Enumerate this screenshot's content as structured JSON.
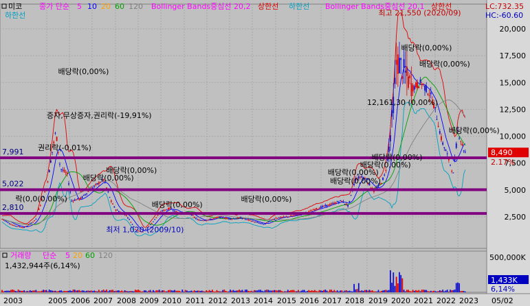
{
  "colors": {
    "bg": "#c0c0c0",
    "plot_bg": "#c0c0c0",
    "grid": "#a8a8a8",
    "up": "#e00000",
    "down": "#1010d0",
    "bb_mid": "#ff00ff",
    "bb_upper": "#e00000",
    "bb_lower": "#00a0c0",
    "ma5": "#ff00ff",
    "ma10": "#0000ff",
    "ma20": "#ffa000",
    "ma60": "#00a000",
    "ma120": "#808080",
    "level_line": "#800080",
    "price_box": "#e00000",
    "volume_box": "#0000c0"
  },
  "header": {
    "stock": "미코",
    "ma_prefix": "종가 단순",
    "ma5": "5",
    "ma10": "10",
    "ma20": "20",
    "ma60": "60",
    "ma120": "120",
    "bb_title": "Bollinger Bands중심선 20,2",
    "bb_upper": "상한선",
    "bb_lower": "하한선",
    "bb_title2": "Bollinger Bands중심선 20,1",
    "bb_upper2": "상한선",
    "bb_lower_line2": "하한선",
    "lc": "LC:732.35",
    "hc": "HC:-60.60"
  },
  "volume_header": {
    "title": "거래량",
    "ma_prefix": "단순",
    "ma5": "5",
    "ma20": "20",
    "ma60": "60",
    "ma120": "120",
    "current": "1,432,944주(6,14%)"
  },
  "chart_data": {
    "type": "candlestick",
    "x_tick_labels": [
      "2003",
      "2005",
      "2006",
      "2007",
      "2008",
      "2009",
      "2010",
      "2011",
      "2012",
      "2013",
      "2014",
      "2015",
      "2016",
      "2017",
      "2018",
      "2019",
      "2020",
      "2021",
      "2022",
      "2023",
      "05/02"
    ],
    "y_tick_labels": [
      "20,000",
      "17,500",
      "15,000",
      "12,500",
      "10,000",
      "7,500",
      "5,000",
      "2,500"
    ],
    "ylim": [
      0,
      21800
    ],
    "price_series": [
      [
        2003.0,
        2300
      ],
      [
        2003.5,
        1700
      ],
      [
        2004.0,
        1500
      ],
      [
        2004.5,
        2200
      ],
      [
        2004.8,
        4200
      ],
      [
        2005.0,
        5200
      ],
      [
        2005.2,
        8000
      ],
      [
        2005.4,
        10500
      ],
      [
        2005.6,
        7000
      ],
      [
        2005.9,
        6500
      ],
      [
        2006.1,
        4000
      ],
      [
        2006.5,
        4200
      ],
      [
        2006.9,
        5000
      ],
      [
        2007.2,
        5500
      ],
      [
        2007.5,
        6000
      ],
      [
        2007.8,
        4000
      ],
      [
        2008.0,
        3200
      ],
      [
        2008.5,
        2600
      ],
      [
        2008.9,
        1300
      ],
      [
        2009.2,
        1100
      ],
      [
        2009.6,
        1900
      ],
      [
        2010.0,
        3000
      ],
      [
        2010.4,
        3300
      ],
      [
        2010.8,
        2800
      ],
      [
        2011.2,
        2900
      ],
      [
        2011.6,
        2200
      ],
      [
        2012.0,
        2200
      ],
      [
        2012.6,
        2500
      ],
      [
        2013.0,
        2300
      ],
      [
        2013.5,
        2400
      ],
      [
        2014.0,
        2100
      ],
      [
        2014.5,
        1800
      ],
      [
        2015.0,
        2400
      ],
      [
        2015.5,
        2500
      ],
      [
        2016.0,
        2700
      ],
      [
        2016.5,
        3000
      ],
      [
        2017.0,
        3400
      ],
      [
        2017.5,
        3700
      ],
      [
        2017.9,
        4000
      ],
      [
        2018.2,
        3500
      ],
      [
        2018.5,
        6000
      ],
      [
        2018.8,
        6300
      ],
      [
        2019.0,
        5800
      ],
      [
        2019.3,
        4900
      ],
      [
        2019.6,
        5600
      ],
      [
        2019.8,
        6500
      ],
      [
        2020.0,
        9500
      ],
      [
        2020.2,
        14000
      ],
      [
        2020.3,
        17000
      ],
      [
        2020.5,
        16500
      ],
      [
        2020.75,
        15500
      ],
      [
        2021.0,
        14500
      ],
      [
        2021.4,
        15000
      ],
      [
        2021.8,
        13800
      ],
      [
        2022.0,
        12500
      ],
      [
        2022.3,
        9500
      ],
      [
        2022.5,
        8500
      ],
      [
        2022.8,
        6500
      ],
      [
        2023.0,
        10500
      ],
      [
        2023.3,
        8490
      ]
    ],
    "current_price": "8,490",
    "current_change": "2.17%",
    "volume_scale_labels": [
      "500,000K",
      "1,433K",
      "6,14%"
    ],
    "levels": [
      {
        "value": 7991,
        "label": "7,991"
      },
      {
        "value": 5022,
        "label": "5,022"
      },
      {
        "value": 2810,
        "label": "2,810"
      }
    ],
    "annotations": [
      {
        "text": "배당락(0,00%)",
        "x": 2005.5,
        "y": 15800
      },
      {
        "text": "증자,무상증자,권리락(-19,91%)",
        "x": 2005.0,
        "y": 11700
      },
      {
        "text": "권리락(-0,01%)",
        "x": 2004.6,
        "y": 8700
      },
      {
        "text": "배당락(0,00%)",
        "x": 2007.6,
        "y": 6600
      },
      {
        "text": "배당락(0,00%)",
        "x": 2006.6,
        "y": 5900
      },
      {
        "text": "락(0,0(0,00%)",
        "x": 2003.6,
        "y": 3950
      },
      {
        "text": "배당락(0,00%)",
        "x": 2009.6,
        "y": 3400
      },
      {
        "text": "배당락(0,00%)",
        "x": 2013.5,
        "y": 3900
      },
      {
        "text": "최저 1,020 (2009/10)",
        "x": 2007.6,
        "y": 1050
      },
      {
        "text": "최고 21,550 (2020/09)",
        "x": 2019.5,
        "y": 21250
      },
      {
        "text": "배당락(0,00%)",
        "x": 2020.5,
        "y": 18000
      },
      {
        "text": "배당락(0,00%)",
        "x": 2021.3,
        "y": 16500
      },
      {
        "text": "12,161,30 (0,00%)",
        "x": 2019.0,
        "y": 12900
      },
      {
        "text": "배당락(0,00%)",
        "x": 2022.6,
        "y": 10300
      },
      {
        "text": "배당락(0,00%)",
        "x": 2019.2,
        "y": 7800
      },
      {
        "text": "배당락(0,00%)",
        "x": 2018.7,
        "y": 7100
      },
      {
        "text": "배당락(0,00%)",
        "x": 2017.3,
        "y": 6400
      },
      {
        "text": "배당락(0,00%)",
        "x": 2017.4,
        "y": 5600
      }
    ]
  }
}
